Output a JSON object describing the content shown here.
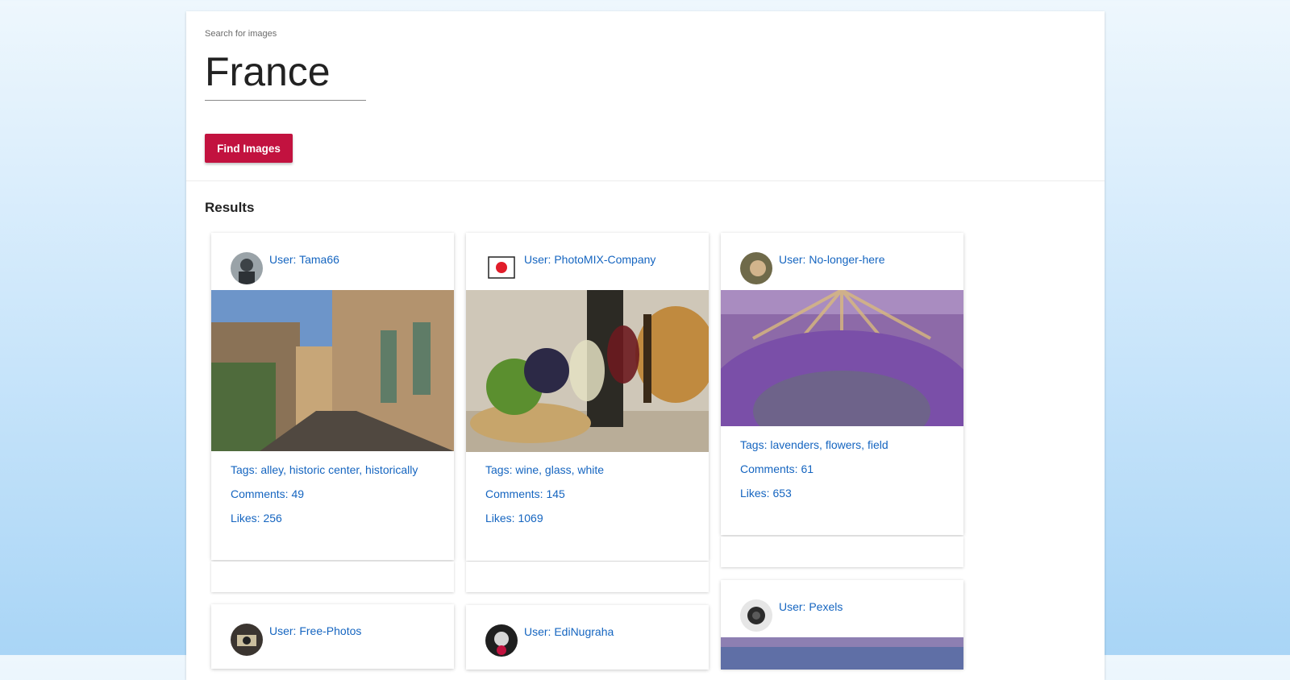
{
  "search": {
    "label": "Search for images",
    "value": "France"
  },
  "button": {
    "find_label": "Find Images"
  },
  "results": {
    "title": "Results",
    "cards": [
      {
        "user": "User: Tama66",
        "tags": "Tags: alley, historic center, historically",
        "comments": "Comments: 49",
        "likes": "Likes: 256"
      },
      {
        "user": "User: PhotoMIX-Company",
        "tags": "Tags: wine, glass, white",
        "comments": "Comments: 145",
        "likes": "Likes: 1069"
      },
      {
        "user": "User: No-longer-here",
        "tags": "Tags: lavenders, flowers, field",
        "comments": "Comments: 61",
        "likes": "Likes: 653"
      },
      {
        "user": "User: Free-Photos"
      },
      {
        "user": "User: EdiNugraha"
      },
      {
        "user": "User: Pexels"
      }
    ]
  },
  "colors": {
    "accent": "#c2123f",
    "link": "#1565c0"
  }
}
